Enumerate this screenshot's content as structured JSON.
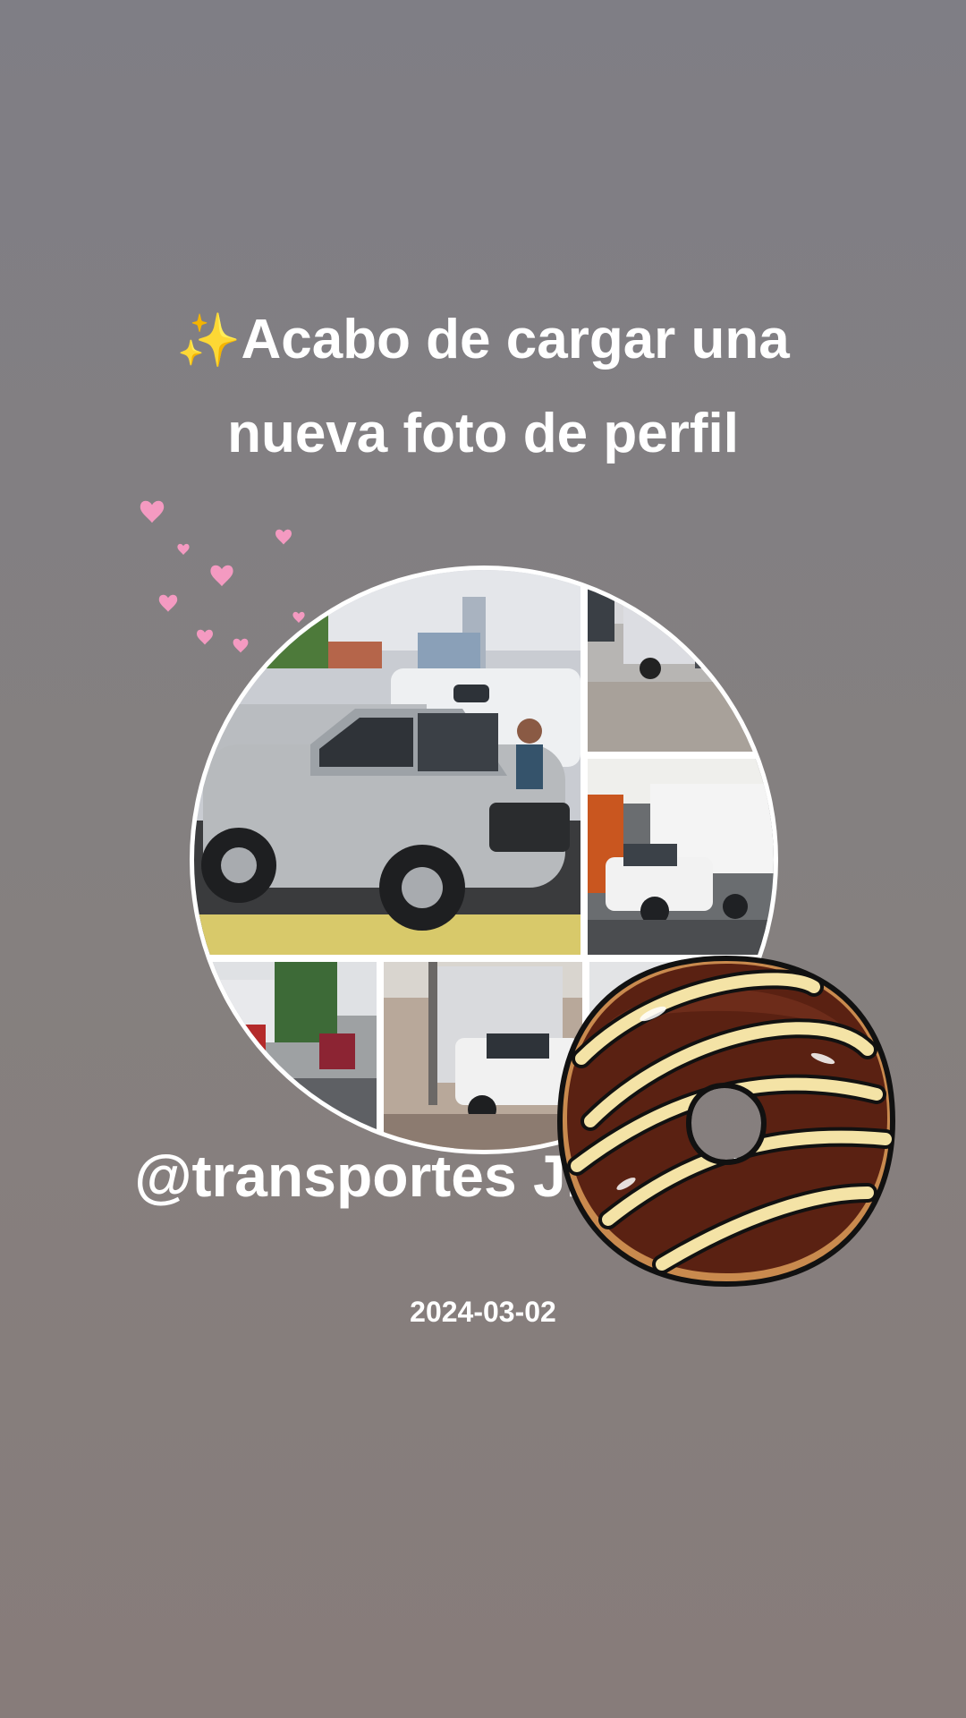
{
  "story": {
    "sparkle_icon": "✨",
    "headline_line1": "Acabo de cargar una",
    "headline_line2": "nueva foto de perfil",
    "username": "@transportes JR santafe",
    "date": "2024-03-02"
  },
  "stickers": {
    "hearts": "hearts-sticker",
    "donut": "chocolate-donut-sticker"
  },
  "colors": {
    "background_top": "#7f7e85",
    "background_bottom": "#877c7a",
    "text": "#ffffff",
    "heart": "#f49ac1",
    "donut_glaze": "#5a2112",
    "donut_icing": "#f4e3a6"
  }
}
